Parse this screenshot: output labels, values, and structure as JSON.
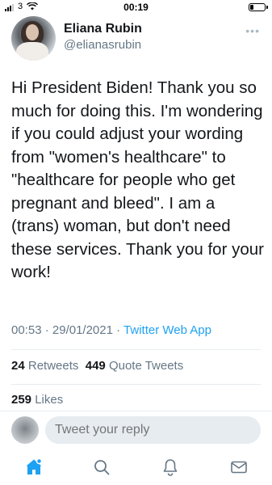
{
  "status_bar": {
    "carrier": "3",
    "time": "00:19",
    "battery_level": 0.25,
    "icons": [
      "signal-icon",
      "wifi-icon",
      "battery-icon"
    ]
  },
  "tweet": {
    "display_name": "Eliana Rubin",
    "handle": "@elianasrubin",
    "text": "Hi President Biden! Thank you so much for doing this. I'm wondering if you could adjust your wording from \"women's healthcare\" to \"healthcare for people who get pregnant and bleed\". I am a (trans) woman, but don't need these services. Thank you for your work!",
    "time": "00:53",
    "date": "29/01/2021",
    "source": "Twitter Web App",
    "separator": "·",
    "more_icon": "more-icon"
  },
  "stats": {
    "retweets_count": "24",
    "retweets_label": "Retweets",
    "quote_count": "449",
    "quote_label": "Quote Tweets",
    "likes_count": "259",
    "likes_label": "Likes"
  },
  "reply": {
    "placeholder": "Tweet your reply"
  },
  "tabbar": {
    "items": [
      "home-icon",
      "search-icon",
      "notifications-icon",
      "messages-icon"
    ],
    "active": "home-icon"
  },
  "colors": {
    "accent": "#1da1f2",
    "text": "#14171a",
    "secondary": "#657786",
    "divider": "#e6ecf0"
  }
}
